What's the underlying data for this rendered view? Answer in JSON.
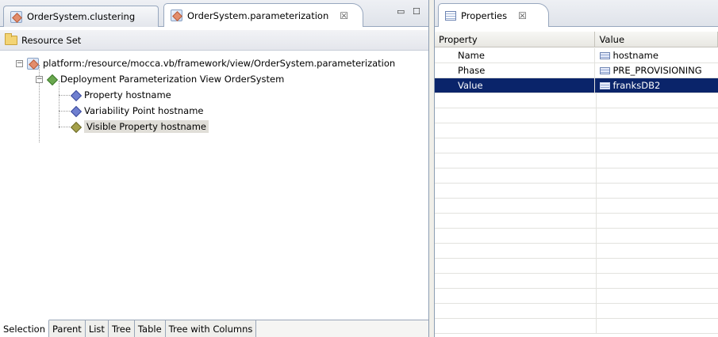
{
  "left_editor": {
    "tabs": [
      {
        "label": "OrderSystem.clustering",
        "active": false
      },
      {
        "label": "OrderSystem.parameterization",
        "active": true
      }
    ],
    "close_glyph": "☒",
    "window_controls": [
      "minimize-icon",
      "maximize-icon"
    ],
    "header": "Resource Set",
    "tree": {
      "root": "platform:/resource/mocca.vb/framework/view/OrderSystem.parameterization",
      "child": "Deployment Parameterization View OrderSystem",
      "items": [
        "Property hostname",
        "Variability Point hostname",
        "Visible Property hostname"
      ],
      "selected_item": "Visible Property hostname"
    },
    "bottom_tabs": [
      "Selection",
      "Parent",
      "List",
      "Tree",
      "Table",
      "Tree with Columns"
    ],
    "active_bottom_tab": "Selection"
  },
  "properties_view": {
    "tab_label": "Properties",
    "columns": [
      "Property",
      "Value"
    ],
    "rows": [
      {
        "property": "Name",
        "value": "hostname"
      },
      {
        "property": "Phase",
        "value": "PRE_PROVISIONING"
      },
      {
        "property": "Value",
        "value": "franksDB2"
      }
    ],
    "selected_row": "Value",
    "colors": {
      "selection": "#0a246a",
      "tab_bar": "#dfe3ea"
    }
  }
}
